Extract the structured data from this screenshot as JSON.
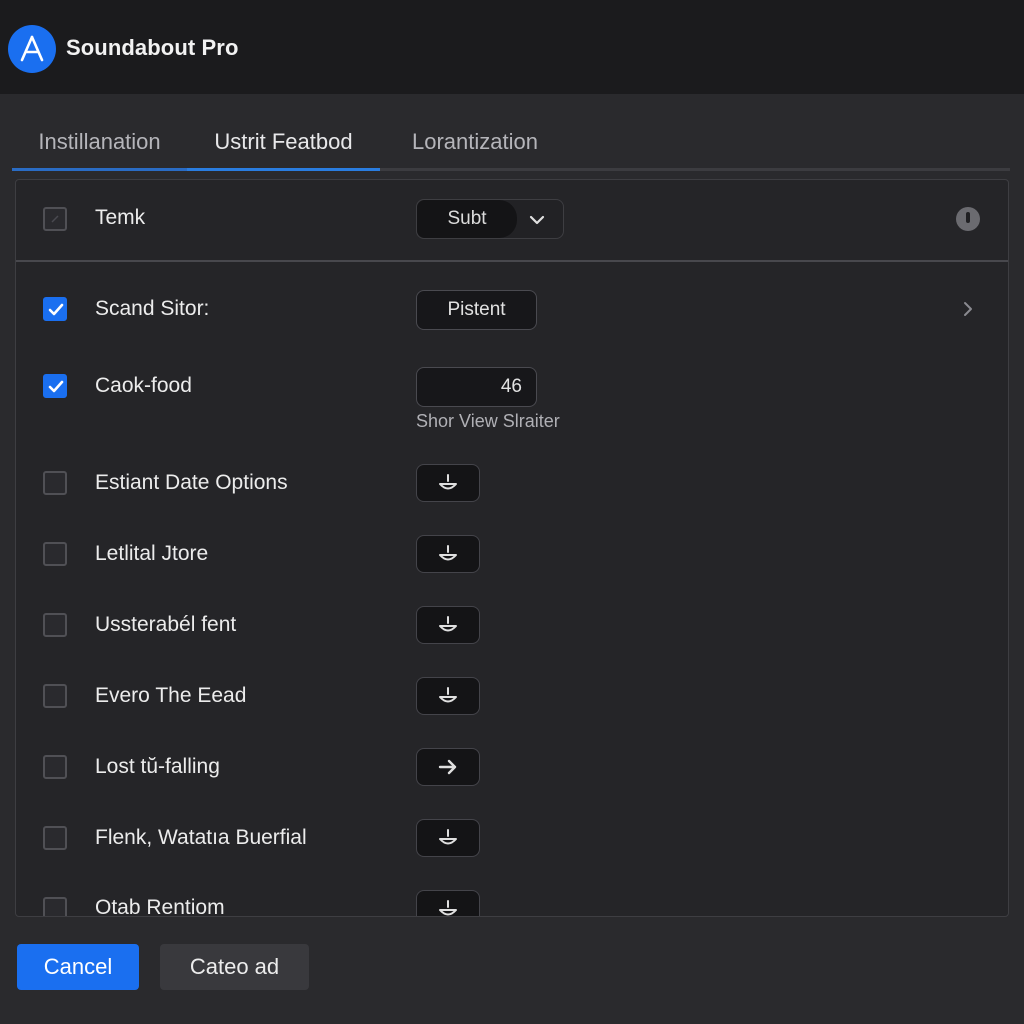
{
  "app": {
    "title": "Soundabout Pro",
    "logo_icon": "app-store-a-icon",
    "accent": "#1a6ff0"
  },
  "tabs": [
    {
      "label": "Instillanation",
      "active": false
    },
    {
      "label": "Ustrit Featbod",
      "active": true
    },
    {
      "label": "Lorantization",
      "active": false
    }
  ],
  "header_row": {
    "label": "Temk",
    "select_value": "Subt",
    "select_icon": "chevron-down-icon",
    "info_icon": "info-icon"
  },
  "rows": [
    {
      "label": "Scand Sitor:",
      "checked": true,
      "control": "Pistent",
      "trailing_icon": "chevron-right-icon"
    },
    {
      "label": "Caok-food",
      "checked": true,
      "control": "46",
      "sublabel": "Shor View Slraiter"
    },
    {
      "label": "Estiant Date Options",
      "checked": false,
      "icon": "bowl-icon"
    },
    {
      "label": "Letlital Jtore",
      "checked": false,
      "icon": "bowl-icon"
    },
    {
      "label": "Ussterabél fent",
      "checked": false,
      "icon": "bowl-icon"
    },
    {
      "label": "Evero The Eead",
      "checked": false,
      "icon": "bowl-icon"
    },
    {
      "label": "Lost tŭ-falling",
      "checked": false,
      "icon": "arrow-right-icon"
    },
    {
      "label": "Flenk, Watatıa Buerfial",
      "checked": false,
      "icon": "bowl-icon"
    },
    {
      "label": "Otab Rentiom",
      "checked": false,
      "icon": "bowl-icon"
    }
  ],
  "footer": {
    "cancel_label": "Cancel",
    "secondary_label": "Cateo ad"
  }
}
